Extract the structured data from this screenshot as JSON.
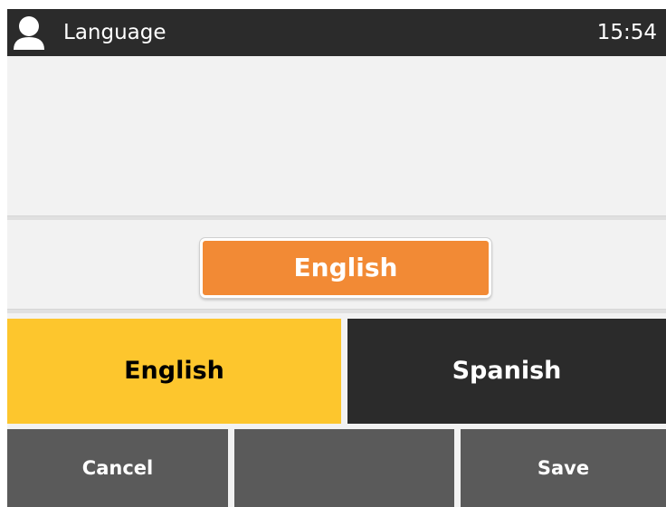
{
  "titlebar": {
    "title": "Language",
    "time": "15:54",
    "icon": "user-icon"
  },
  "selection": {
    "current_value": "English"
  },
  "options": [
    {
      "label": "English",
      "selected": true,
      "color": "#fdc62d"
    },
    {
      "label": "Spanish",
      "selected": false,
      "color": "#2b2b2b"
    }
  ],
  "softkeys": {
    "left": "Cancel",
    "middle": "",
    "right": "Save"
  },
  "colors": {
    "accent": "#f28a35",
    "highlight": "#fdc62d",
    "titlebar_bg": "#2b2b2b",
    "softkey_bg": "#5a5a5a"
  }
}
